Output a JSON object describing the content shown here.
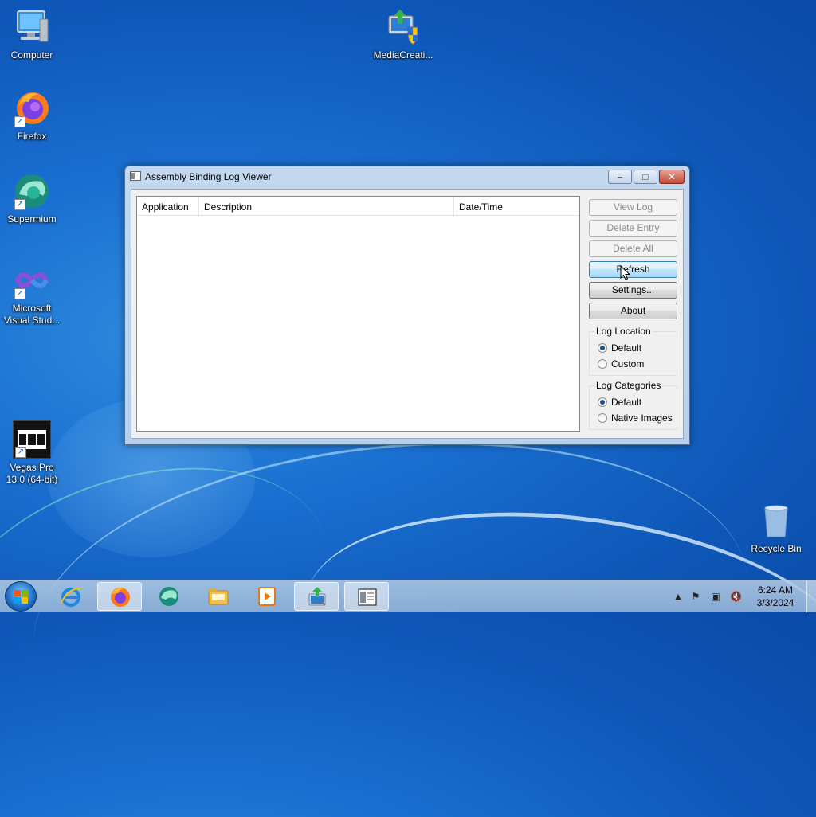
{
  "desktop": {
    "icons": [
      {
        "label": "Computer",
        "icon": "computer-icon"
      },
      {
        "label": "MediaCreati...",
        "icon": "media-creation-tool-icon"
      },
      {
        "label": "Firefox",
        "icon": "firefox-icon"
      },
      {
        "label": "Supermium",
        "icon": "supermium-icon"
      },
      {
        "label": "Microsoft Visual Stud...",
        "icon": "visual-studio-icon"
      },
      {
        "label": "Vegas Pro 13.0 (64-bit)",
        "icon": "vegas-pro-icon"
      },
      {
        "label": "Recycle Bin",
        "icon": "recycle-bin-icon"
      }
    ]
  },
  "window": {
    "title": "Assembly Binding Log Viewer",
    "columns": [
      "Application",
      "Description",
      "Date/Time"
    ],
    "rows": [],
    "buttons": {
      "view_log": "View Log",
      "delete_entry": "Delete Entry",
      "delete_all": "Delete All",
      "refresh": "Refresh",
      "settings": "Settings...",
      "about": "About"
    },
    "log_location": {
      "label": "Log Location",
      "options": [
        "Default",
        "Custom"
      ],
      "selected": "Default"
    },
    "log_categories": {
      "label": "Log Categories",
      "options": [
        "Default",
        "Native Images"
      ],
      "selected": "Default"
    }
  },
  "taskbar": {
    "apps": [
      "internet-explorer-icon",
      "firefox-icon",
      "supermium-icon",
      "file-explorer-icon",
      "media-player-icon",
      "media-creation-tool-icon",
      "fuslogvw-icon"
    ],
    "active_app": "fuslogvw-icon",
    "clock": {
      "time": "6:24 AM",
      "date": "3/3/2024"
    }
  }
}
